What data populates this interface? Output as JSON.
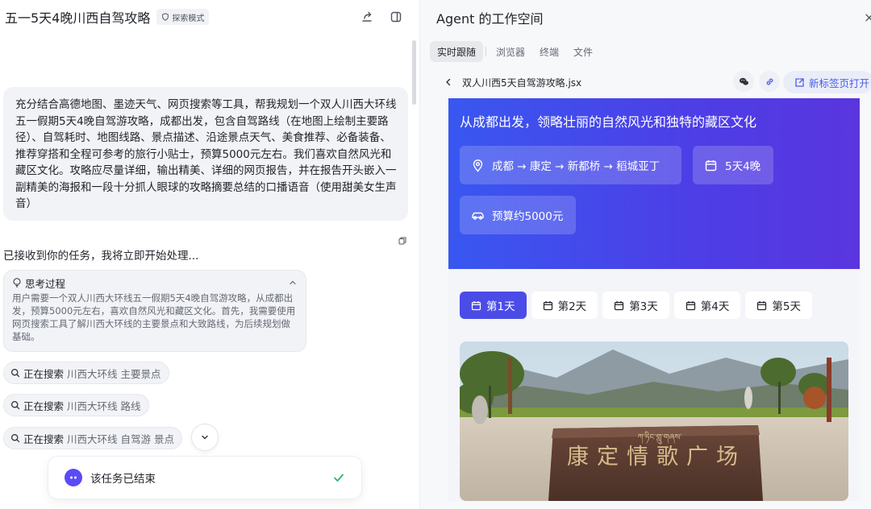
{
  "chat": {
    "title": "五一5天4晚川西自驾攻略",
    "mode_badge": "探索模式",
    "user_message": "充分结合高德地图、墨迹天气、网页搜索等工具，帮我规划一个双人川西大环线五一假期5天4晚自驾游攻略，成都出发，包含自驾路线（在地图上绘制主要路径）、自驾耗时、地图线路、景点描述、沿途景点天气、美食推荐、必备装备、推荐穿搭和全程可参考的旅行小贴士，预算5000元左右。我们喜欢自然风光和藏区文化。攻略应尽量详细，输出精美、详细的网页报告，并在报告开头嵌入一副精美的海报和一段十分抓人眼球的攻略摘要总结的口播语音（使用甜美女生声音）",
    "ack": "已接收到你的任务，我将立即开始处理...",
    "thinking": {
      "title": "思考过程",
      "body": "用户需要一个双人川西大环线五一假期5天4晚自驾游攻略，从成都出发，预算5000元左右，喜欢自然风光和藏区文化。首先，我需要使用网页搜索工具了解川西大环线的主要景点和大致路线，为后续规划做基础。"
    },
    "searches": [
      {
        "label": "正在搜索",
        "query": "川西大环线 主要景点"
      },
      {
        "label": "正在搜索",
        "query": "川西大环线 路线"
      },
      {
        "label": "正在搜索",
        "query": "川西大环线 自驾游 景点"
      }
    ],
    "status": "该任务已结束"
  },
  "workspace": {
    "title": "Agent 的工作空间",
    "close": "×",
    "tabs": [
      "实时跟随",
      "浏览器",
      "终端",
      "文件"
    ],
    "active_tab": 0,
    "file_name": "双人川西5天自驾游攻略.jsx",
    "new_tab_label": "新标签页打开",
    "hero": {
      "subtitle": "从成都出发，领略壮丽的自然风光和独特的藏区文化",
      "route": "成都 → 康定 → 新都桥 → 稻城亚丁",
      "duration": "5天4晚",
      "budget": "预算约5000元"
    },
    "days": [
      "第1天",
      "第2天",
      "第3天",
      "第4天",
      "第5天"
    ],
    "active_day": 0,
    "photo": {
      "tibetan_text": "ཀ་ཏིང་གླུ་གཞས་",
      "sign_text": "康定情歌广场"
    }
  },
  "colors": {
    "accent": "#4b4ce8",
    "hero_start": "#3957f0",
    "hero_end": "#5a35de",
    "check": "#2fb36a"
  }
}
